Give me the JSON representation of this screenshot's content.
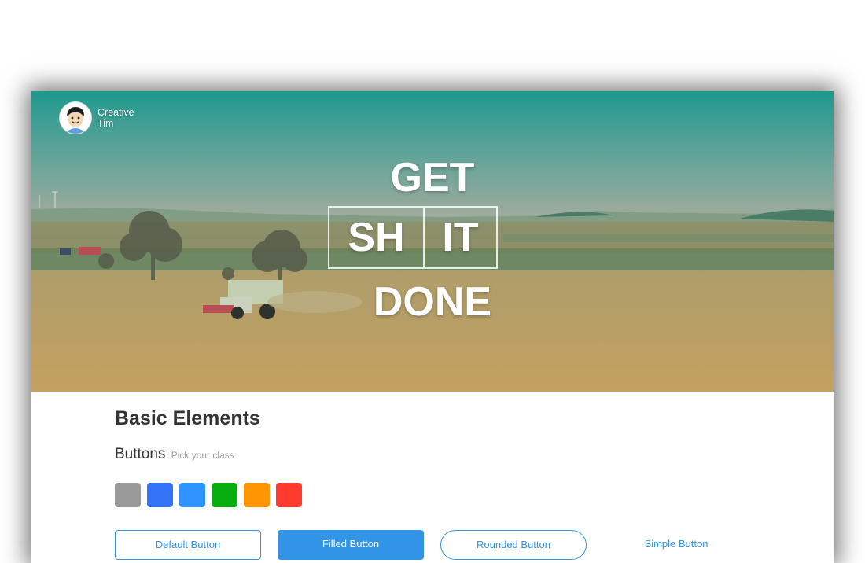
{
  "brand": {
    "name": "Creative Tim"
  },
  "hero": {
    "line1": "GET",
    "box_left": "SH",
    "box_right": "IT",
    "line3": "DONE"
  },
  "section": {
    "title": "Basic Elements",
    "buttons_heading": "Buttons",
    "buttons_hint": "Pick your class"
  },
  "swatches": [
    {
      "name": "default",
      "color": "#9a9a9a"
    },
    {
      "name": "primary",
      "color": "#3472f7"
    },
    {
      "name": "info",
      "color": "#2c93ff"
    },
    {
      "name": "success",
      "color": "#05ae0e"
    },
    {
      "name": "warning",
      "color": "#ff9500"
    },
    {
      "name": "danger",
      "color": "#ff3b30"
    }
  ],
  "buttons": {
    "default": "Default Button",
    "fill": "Filled Button",
    "round": "Rounded Button",
    "simple": "Simple Button"
  },
  "colors": {
    "accent": "#3294e6"
  }
}
